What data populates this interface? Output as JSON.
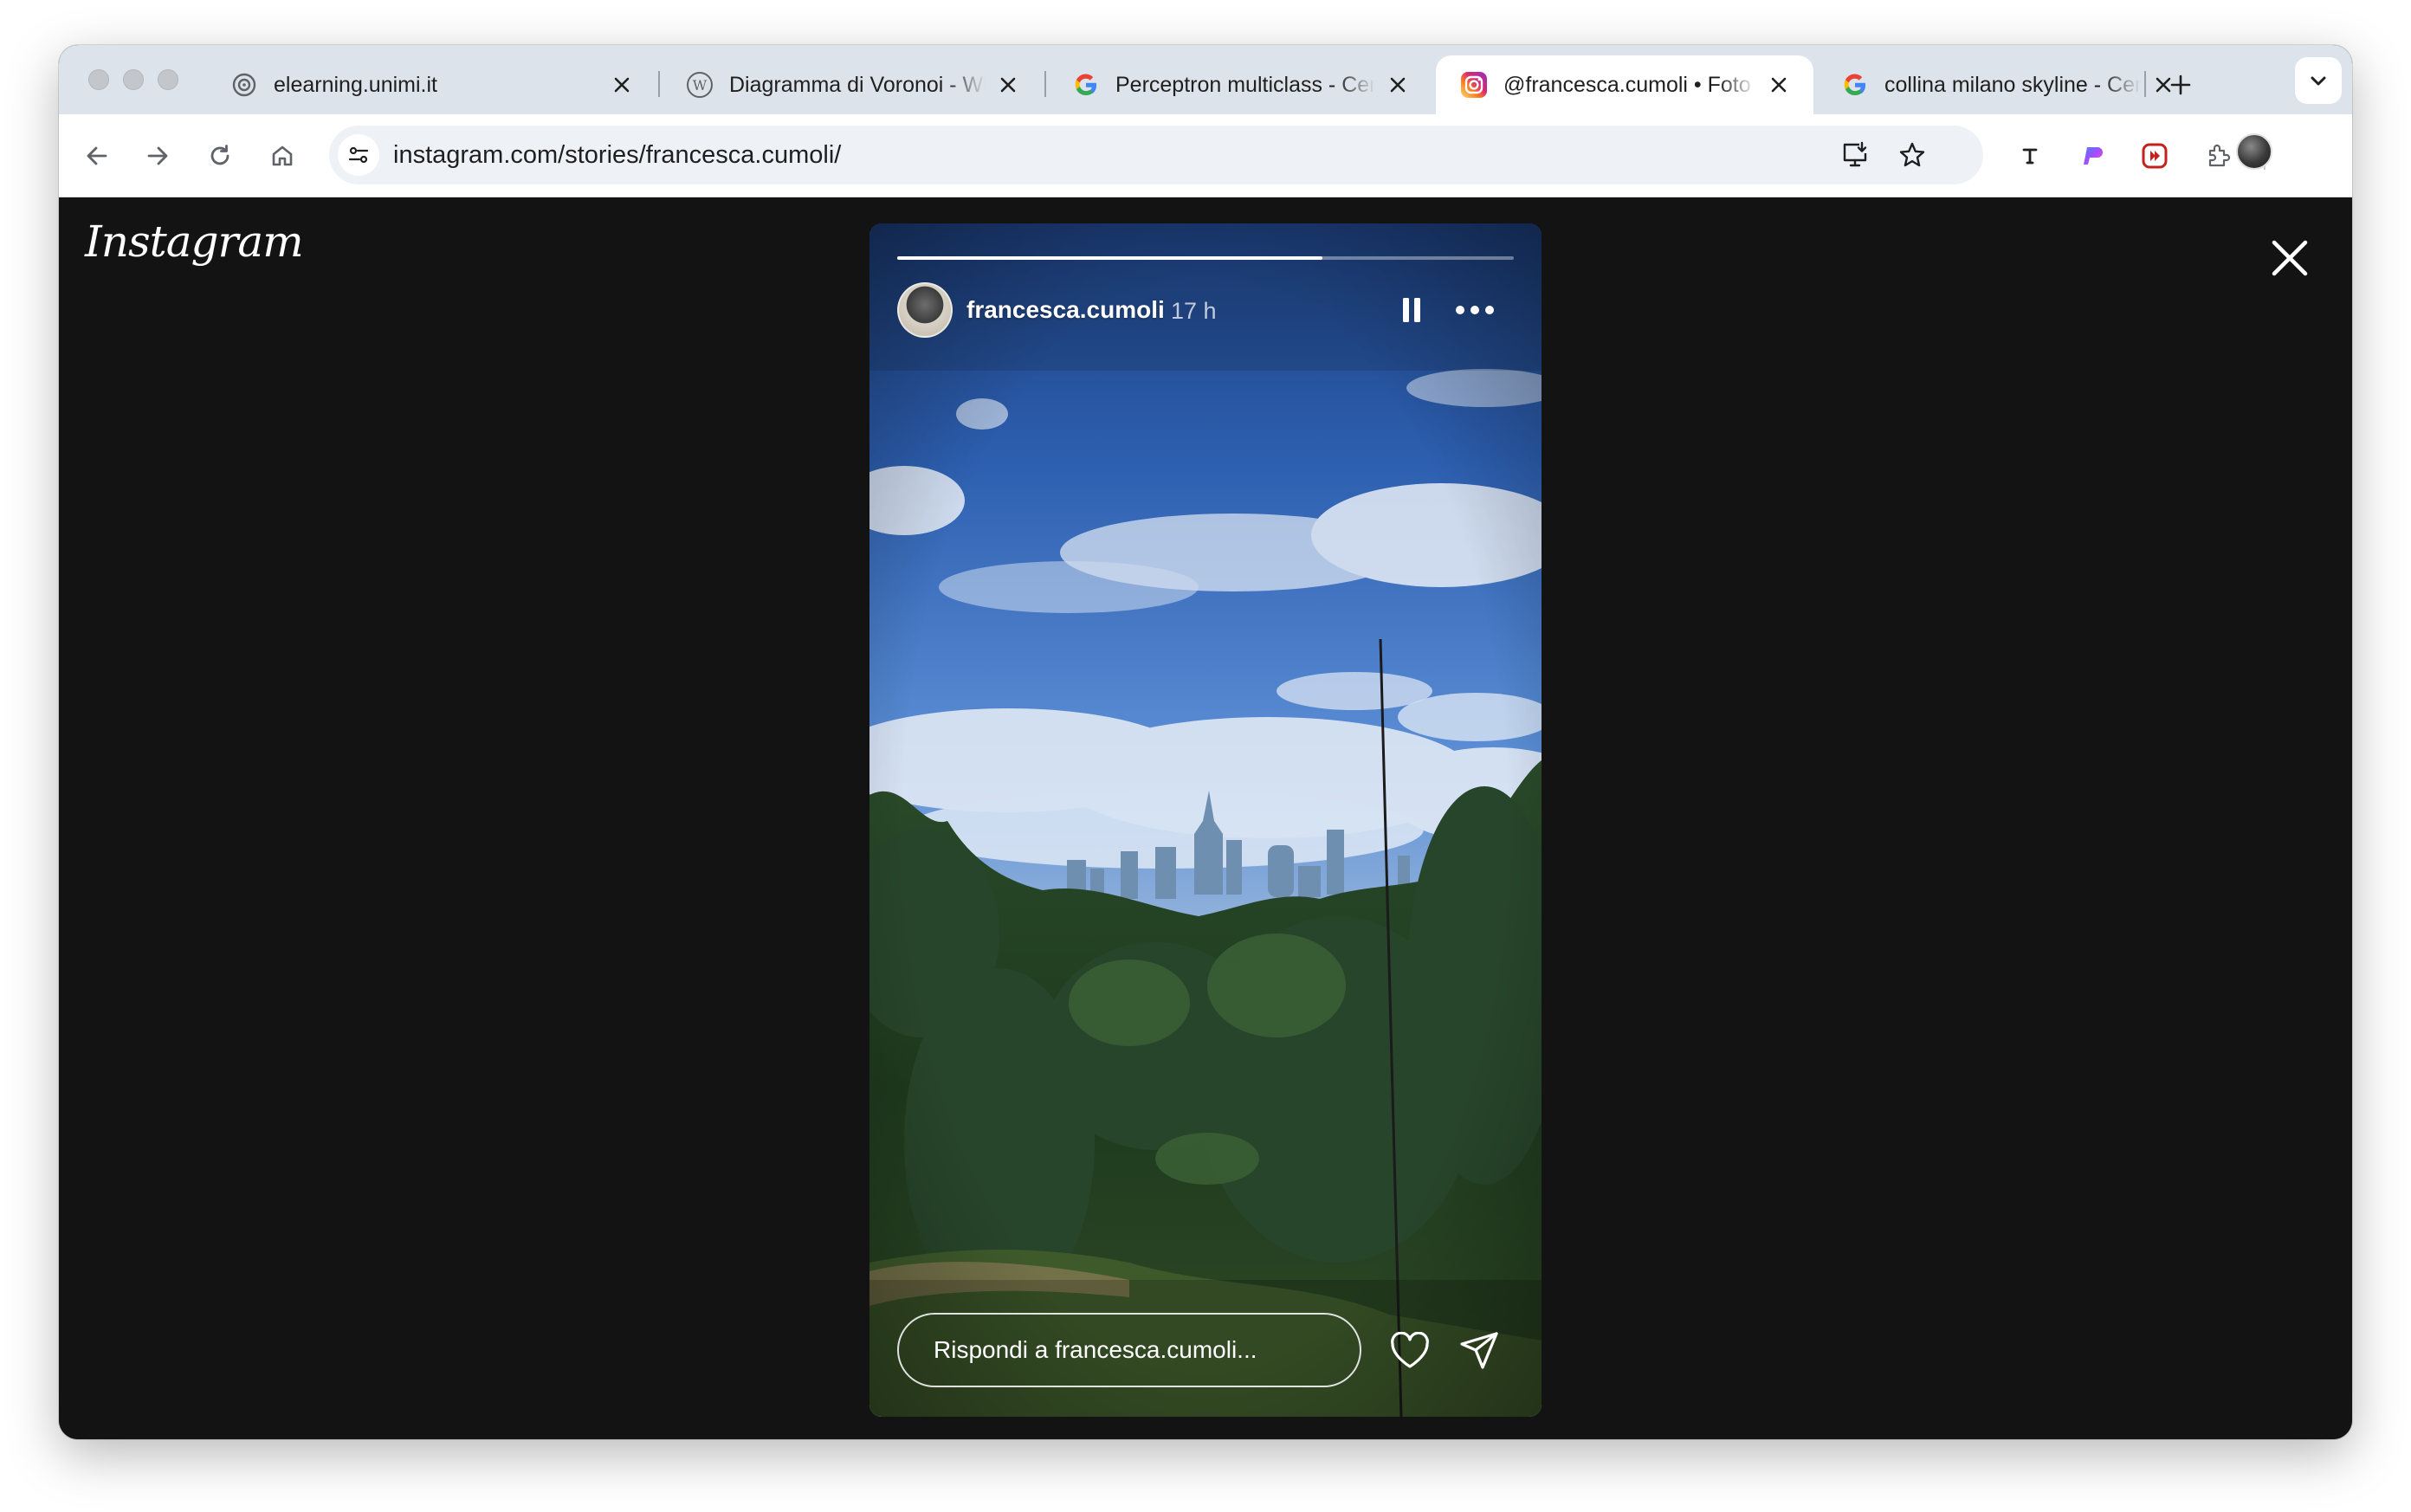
{
  "browser": {
    "tabs": [
      {
        "title": "elearning.unimi.it",
        "favicon": "moodle-icon",
        "active": false
      },
      {
        "title": "Diagramma di Voronoi - Wikipedia",
        "favicon": "wikipedia-icon",
        "active": false
      },
      {
        "title": "Perceptron multiclass - Cerca con Google",
        "favicon": "google-icon",
        "active": false
      },
      {
        "title": "@francesca.cumoli • Foto e video di Instagram",
        "favicon": "instagram-icon",
        "active": true
      },
      {
        "title": "collina milano skyline - Cerca con Google",
        "favicon": "google-icon",
        "active": false
      }
    ],
    "address": {
      "host": "instagram.com",
      "path": "/stories/francesca.cumoli/"
    }
  },
  "instagram": {
    "logo": "Instagram",
    "story": {
      "username": "francesca.cumoli",
      "time_ago": "17 h",
      "progress": 0.69,
      "reply_placeholder": "Rispondi a francesca.cumoli..."
    }
  },
  "colors": {
    "tabstrip": "#dde3ea",
    "background": "#131313",
    "instagram_gradient": [
      "#feda75",
      "#d62976",
      "#962fbf",
      "#4f5bd5"
    ]
  }
}
